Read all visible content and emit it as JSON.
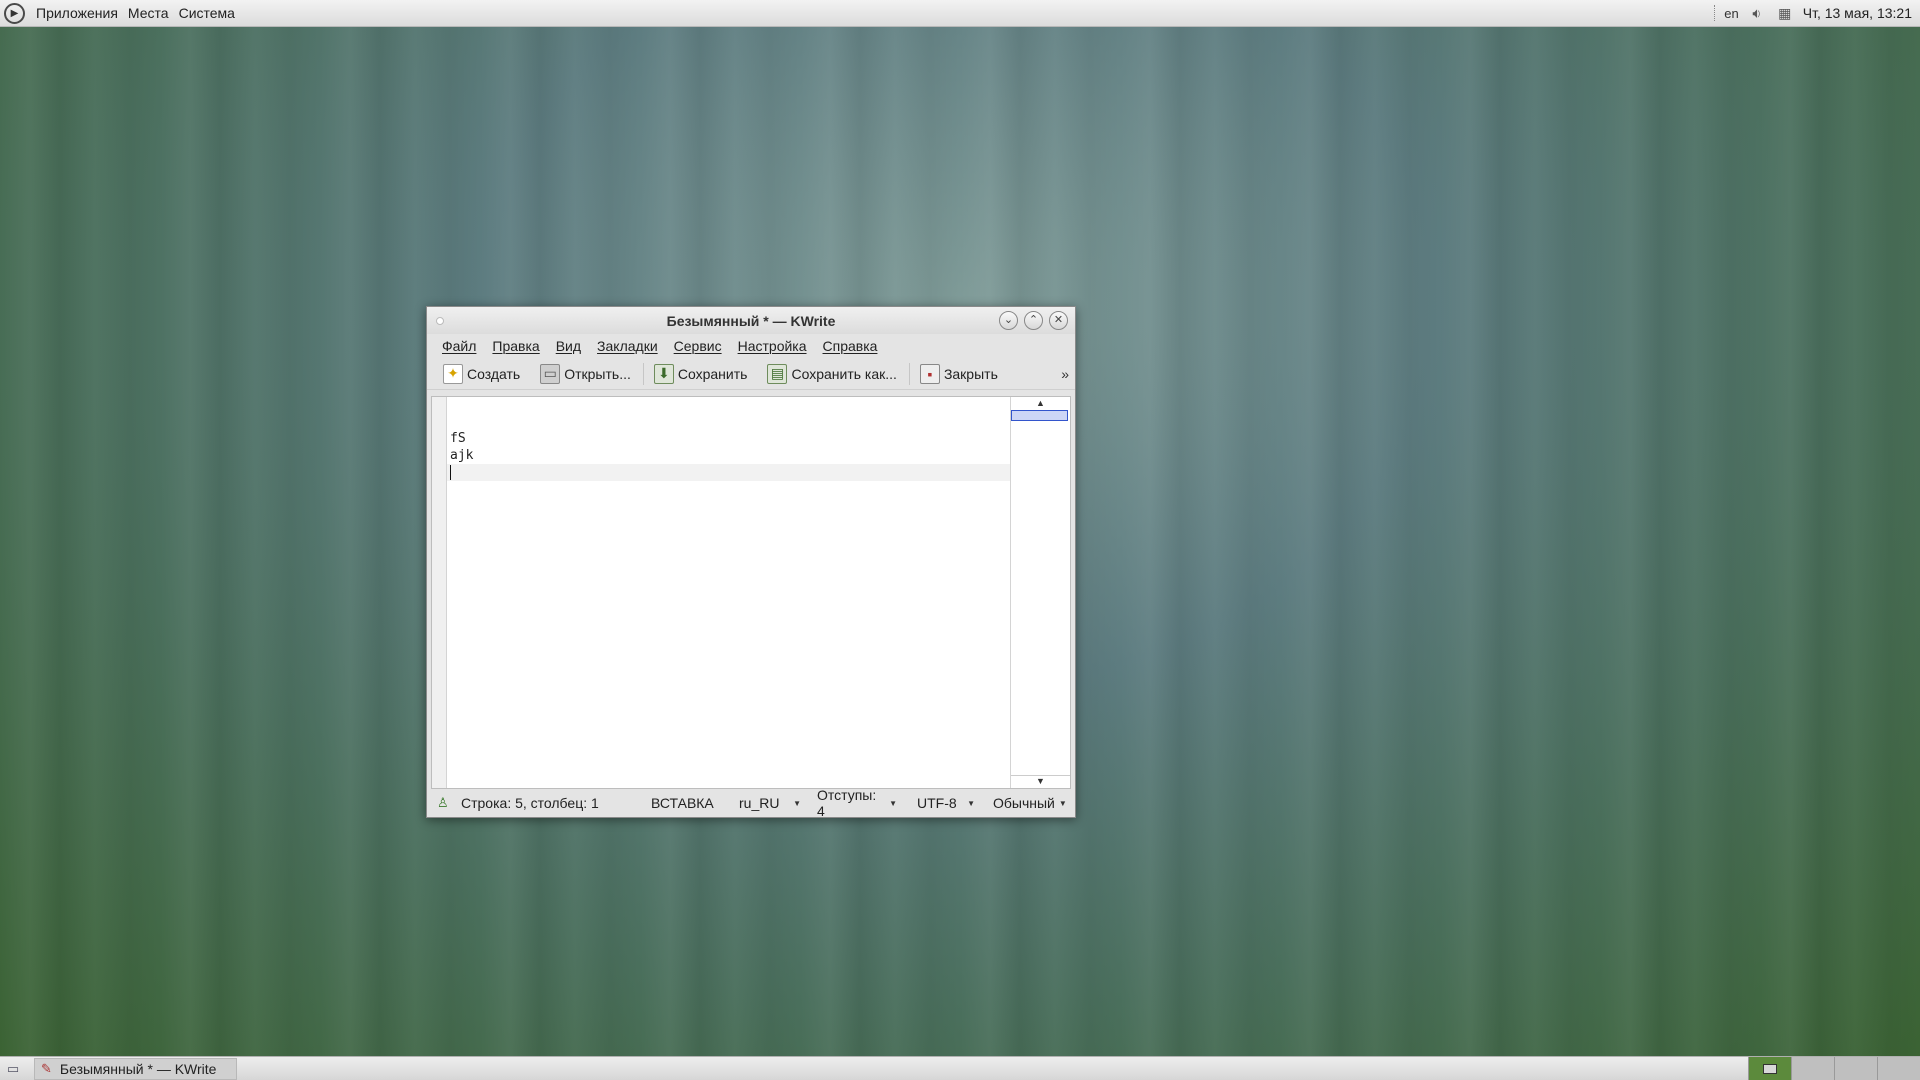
{
  "top_panel": {
    "menu": [
      "Приложения",
      "Места",
      "Система"
    ],
    "tray": {
      "language": "en",
      "clock": "Чт, 13 мая, 13:21",
      "icons": [
        "volume-icon",
        "network-icon"
      ]
    }
  },
  "window": {
    "title": "Безымянный * — KWrite",
    "menubar": [
      "Файл",
      "Правка",
      "Вид",
      "Закладки",
      "Сервис",
      "Настройка",
      "Справка"
    ],
    "toolbar": {
      "new": "Создать",
      "open": "Открыть...",
      "save": "Сохранить",
      "save_as": "Сохранить как...",
      "close": "Закрыть",
      "more": "»"
    },
    "editor": {
      "lines": [
        "",
        "",
        "fS",
        "ajk",
        ""
      ],
      "current_line": 5
    },
    "statusbar": {
      "position": "Строка: 5, столбец: 1",
      "mode": "ВСТАВКА",
      "dictionary": "ru_RU",
      "indent": "Отступы: 4",
      "encoding": "UTF-8",
      "highlighting": "Обычный"
    }
  },
  "taskbar": {
    "tasks": [
      {
        "label": "Безымянный * — KWrite",
        "icon": "kwrite-icon"
      }
    ],
    "workspaces": 4,
    "active_workspace": 1
  },
  "colors": {
    "desktop_top": "#7f9b98",
    "desktop_bottom": "#3a6231",
    "workspace_active": "#5c8a3c",
    "minimap_slider": "#3355cc"
  }
}
